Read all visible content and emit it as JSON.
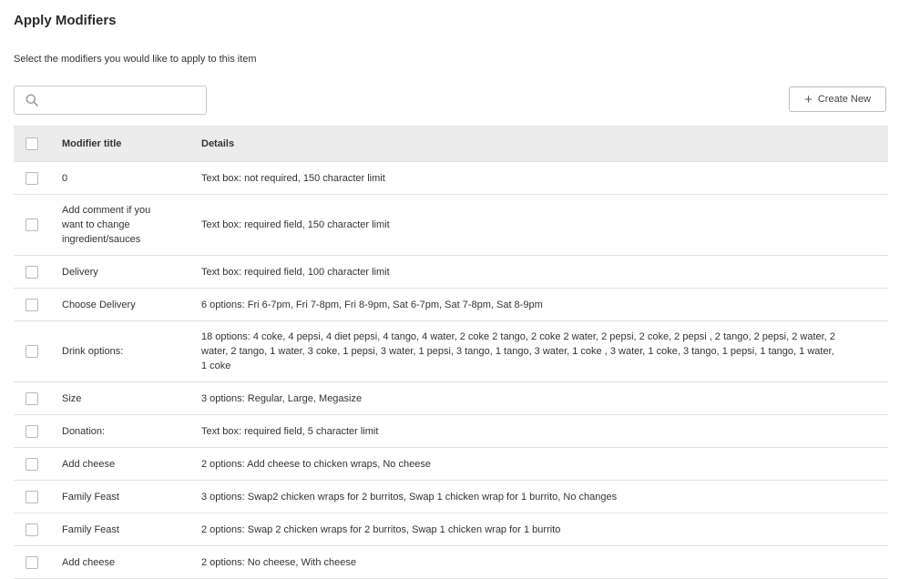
{
  "header": {
    "title": "Apply Modifiers",
    "subtitle": "Select the modifiers you would like to apply to this item"
  },
  "search": {
    "placeholder": "",
    "value": ""
  },
  "create_button": {
    "label": "Create New",
    "icon": "plus-icon"
  },
  "table": {
    "columns": [
      "Modifier title",
      "Details"
    ],
    "rows": [
      {
        "title": "0",
        "details": "Text box: not required, 150 character limit"
      },
      {
        "title": "Add comment if you want to change ingredient/sauces",
        "details": "Text box: required field, 150 character limit"
      },
      {
        "title": "Delivery",
        "details": "Text box: required field, 100 character limit"
      },
      {
        "title": "Choose Delivery",
        "details": "6 options: Fri 6-7pm, Fri 7-8pm, Fri 8-9pm, Sat 6-7pm, Sat 7-8pm, Sat 8-9pm"
      },
      {
        "title": "Drink options:",
        "details": "18 options: 4 coke, 4 pepsi, 4 diet pepsi, 4 tango, 4 water, 2 coke 2 tango, 2 coke 2 water, 2 pepsi, 2 coke, 2 pepsi , 2 tango, 2 pepsi, 2 water, 2 water, 2 tango, 1 water, 3 coke, 1 pepsi, 3 water, 1 pepsi, 3 tango, 1 tango, 3 water, 1 coke , 3 water, 1 coke, 3 tango, 1 pepsi, 1 tango, 1 water, 1 coke"
      },
      {
        "title": "Size",
        "details": "3 options: Regular, Large, Megasize"
      },
      {
        "title": "Donation:",
        "details": "Text box: required field, 5 character limit"
      },
      {
        "title": "Add cheese",
        "details": "2 options: Add cheese to chicken wraps, No cheese"
      },
      {
        "title": "Family Feast",
        "details": "3 options: Swap2 chicken wraps for 2 burritos, Swap 1 chicken wrap for 1 burrito, No changes"
      },
      {
        "title": "Family Feast",
        "details": "2 options: Swap 2 chicken wraps for 2 burritos, Swap 1 chicken wrap for 1 burrito"
      },
      {
        "title": "Add cheese",
        "details": "2 options: No cheese, With cheese"
      }
    ]
  }
}
